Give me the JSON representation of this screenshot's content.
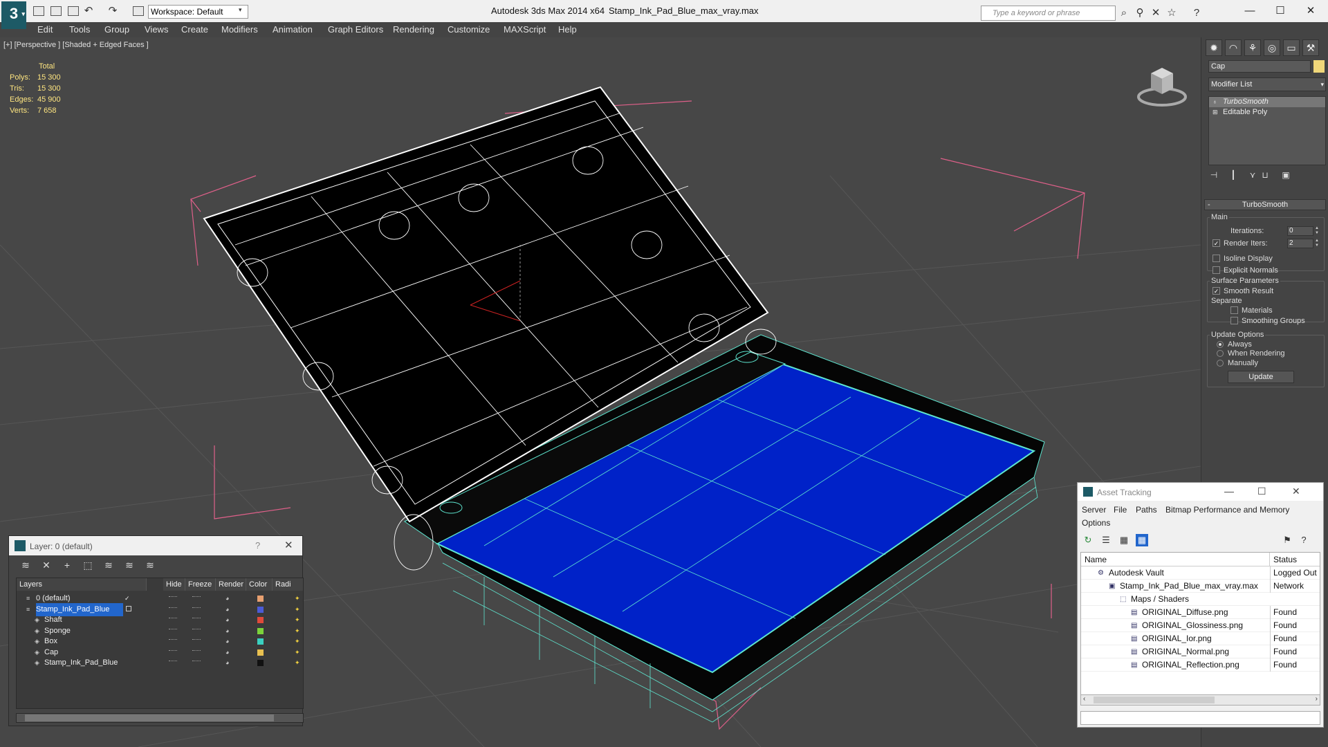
{
  "titlebar": {
    "workspace_label": "Workspace: Default",
    "app_title": "Autodesk 3ds Max  2014 x64",
    "file_title": "Stamp_Ink_Pad_Blue_max_vray.max",
    "search_placeholder": "Type a keyword or phrase"
  },
  "menu": [
    "Edit",
    "Tools",
    "Group",
    "Views",
    "Create",
    "Modifiers",
    "Animation",
    "Graph Editors",
    "Rendering",
    "Customize",
    "MAXScript",
    "Help"
  ],
  "viewport": {
    "label": "[+] [Perspective ] [Shaded + Edged Faces ]",
    "stats_header": "Total",
    "stats": [
      {
        "label": "Polys:",
        "value": "15 300"
      },
      {
        "label": "Tris:",
        "value": "15 300"
      },
      {
        "label": "Edges:",
        "value": "45 900"
      },
      {
        "label": "Verts:",
        "value": "7 658"
      }
    ],
    "colors": {
      "background": "#474747",
      "grid": "#5a5a5a",
      "wire_white": "#ffffff",
      "wire_cyan": "#5ee6d0",
      "pad_blue": "#0022c8",
      "bbox_pink": "#e0608a"
    }
  },
  "command_panel": {
    "object_name": "Cap",
    "object_color": "#f0d77a",
    "modifier_list_label": "Modifier List",
    "stack": [
      {
        "label": "TurboSmooth",
        "selected": true
      },
      {
        "label": "Editable Poly",
        "selected": false
      }
    ],
    "turbosmooth": {
      "title": "TurboSmooth",
      "main_label": "Main",
      "iterations_label": "Iterations:",
      "iterations_value": "0",
      "render_iters_label": "Render Iters:",
      "render_iters_value": "2",
      "isoline_label": "Isoline Display",
      "explicit_normals_label": "Explicit Normals",
      "surface_params_label": "Surface Parameters",
      "smooth_result_label": "Smooth Result",
      "separate_label": "Separate",
      "materials_label": "Materials",
      "smoothing_groups_label": "Smoothing Groups",
      "update_options_label": "Update Options",
      "always_label": "Always",
      "when_rendering_label": "When Rendering",
      "manually_label": "Manually",
      "update_button": "Update"
    }
  },
  "layer_dialog": {
    "title": "Layer: 0 (default)",
    "help": "?",
    "columns": [
      "Layers",
      "Hide",
      "Freeze",
      "Render",
      "Color",
      "Radi"
    ],
    "rows": [
      {
        "name": "0 (default)",
        "indent": 0,
        "color": "#e8a070",
        "selected": false,
        "current": true
      },
      {
        "name": "Stamp_Ink_Pad_Blue",
        "indent": 0,
        "color": "#4b5bd6",
        "selected": true,
        "current": false
      },
      {
        "name": "Shaft",
        "indent": 1,
        "color": "#e04a3a",
        "selected": false,
        "current": false
      },
      {
        "name": "Sponge",
        "indent": 1,
        "color": "#7bd23a",
        "selected": false,
        "current": false
      },
      {
        "name": "Box",
        "indent": 1,
        "color": "#3ad0c0",
        "selected": false,
        "current": false
      },
      {
        "name": "Cap",
        "indent": 1,
        "color": "#e8c050",
        "selected": false,
        "current": false
      },
      {
        "name": "Stamp_Ink_Pad_Blue",
        "indent": 1,
        "color": "#111111",
        "selected": false,
        "current": false
      }
    ]
  },
  "asset_dialog": {
    "title": "Asset Tracking",
    "menus": [
      "Server",
      "File",
      "Paths",
      "Bitmap Performance and Memory",
      "Options"
    ],
    "columns": [
      "Name",
      "Status"
    ],
    "rows": [
      {
        "name": "Autodesk Vault",
        "indent": 1,
        "status": "Logged Out"
      },
      {
        "name": "Stamp_Ink_Pad_Blue_max_vray.max",
        "indent": 2,
        "status": "Network"
      },
      {
        "name": "Maps / Shaders",
        "indent": 3,
        "status": ""
      },
      {
        "name": "ORIGINAL_Diffuse.png",
        "indent": 4,
        "status": "Found"
      },
      {
        "name": "ORIGINAL_Glossiness.png",
        "indent": 4,
        "status": "Found"
      },
      {
        "name": "ORIGINAL_Ior.png",
        "indent": 4,
        "status": "Found"
      },
      {
        "name": "ORIGINAL_Normal.png",
        "indent": 4,
        "status": "Found"
      },
      {
        "name": "ORIGINAL_Reflection.png",
        "indent": 4,
        "status": "Found"
      }
    ]
  }
}
